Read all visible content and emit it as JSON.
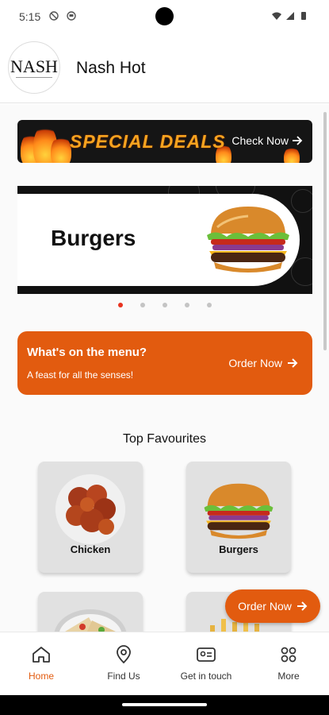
{
  "status_bar": {
    "time": "5:15"
  },
  "header": {
    "logo_text": "NASH",
    "title": "Nash Hot"
  },
  "deals_banner": {
    "title": "SPECIAL DEALS",
    "action": "Check Now"
  },
  "carousel": {
    "title": "Burgers",
    "page_count": 5,
    "active_index": 0
  },
  "menu_card": {
    "title": "What's on the menu?",
    "subtitle": "A feast for all the senses!",
    "action": "Order Now"
  },
  "favourites": {
    "title": "Top Favourites",
    "items": [
      {
        "label": "Chicken"
      },
      {
        "label": "Burgers"
      }
    ]
  },
  "fab": {
    "label": "Order Now"
  },
  "bottom_nav": {
    "items": [
      {
        "label": "Home",
        "icon": "home-icon",
        "active": true
      },
      {
        "label": "Find Us",
        "icon": "location-pin-icon",
        "active": false
      },
      {
        "label": "Get in touch",
        "icon": "contact-card-icon",
        "active": false
      },
      {
        "label": "More",
        "icon": "grid-icon",
        "active": false
      }
    ]
  },
  "colors": {
    "accent": "#e25b0f",
    "dot_active": "#e8331f",
    "deals_text": "#f7a31f"
  }
}
